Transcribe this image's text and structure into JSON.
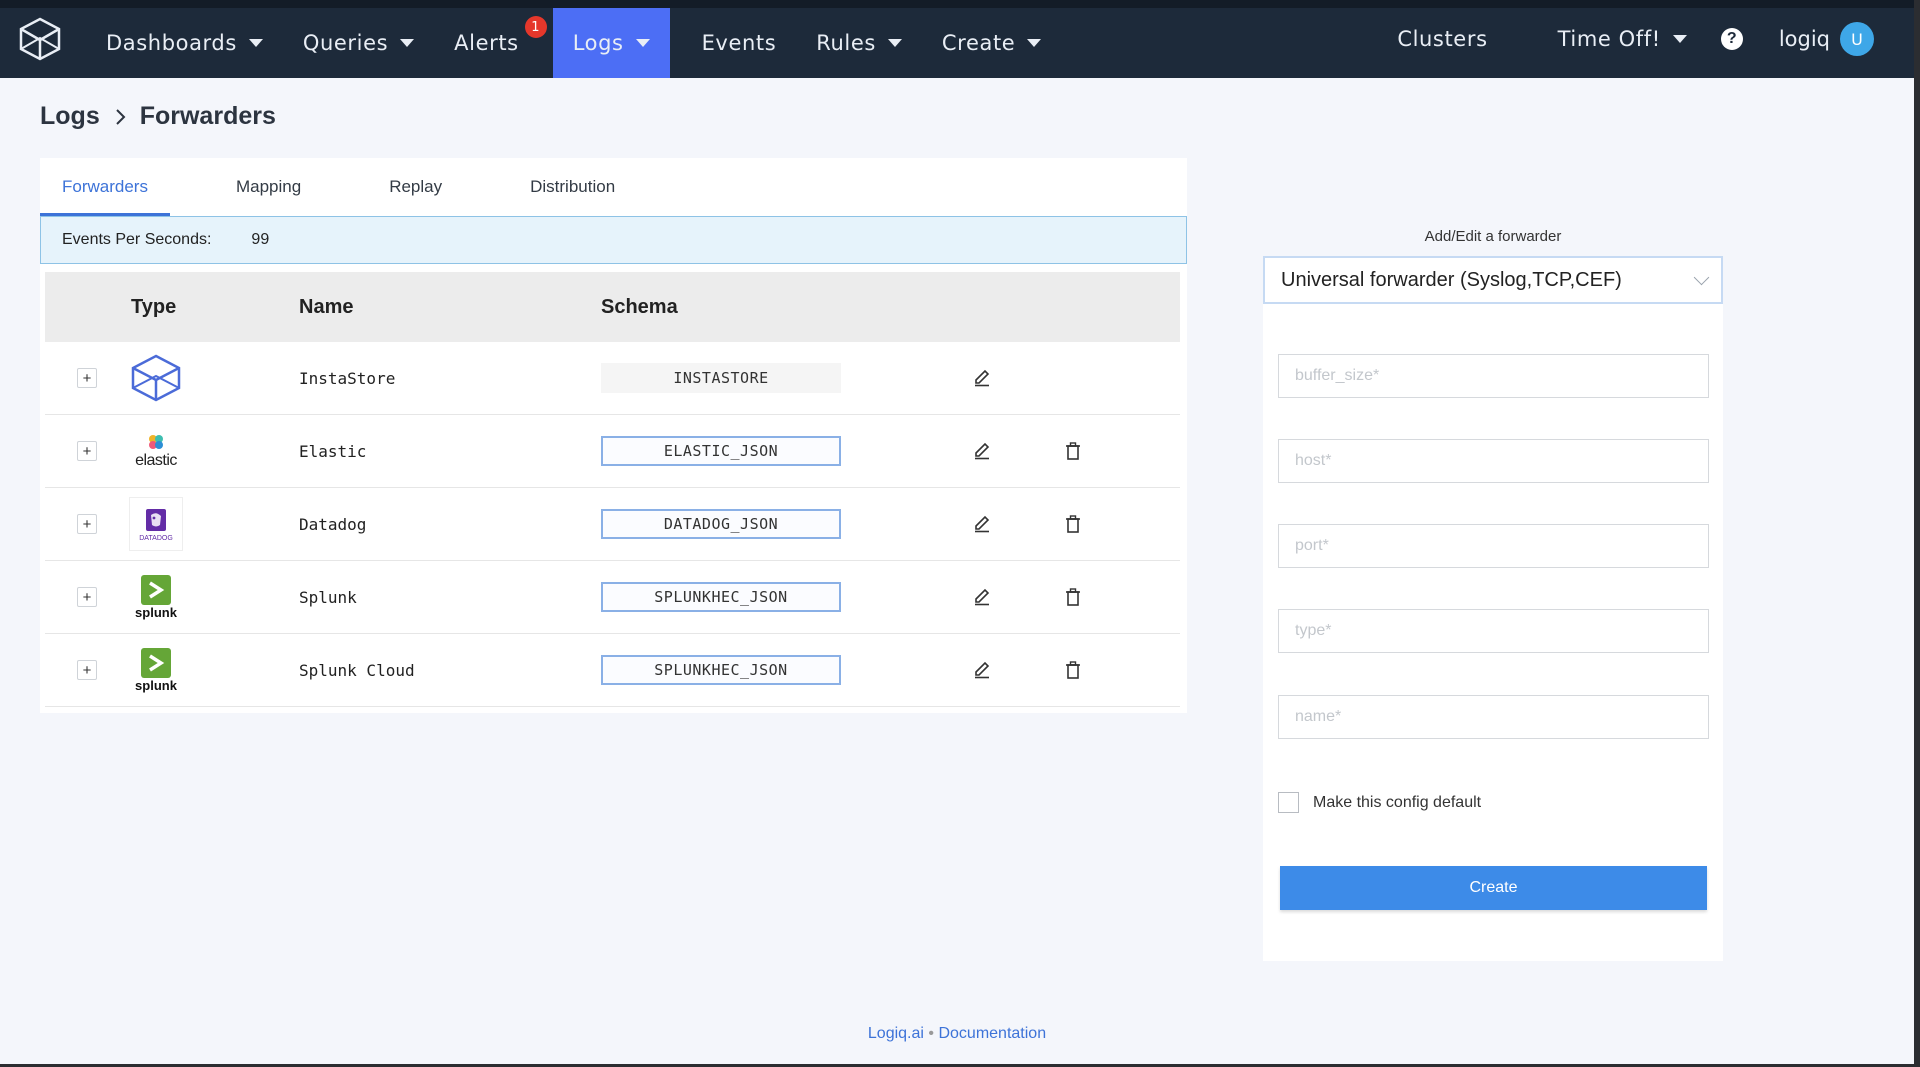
{
  "nav": {
    "items": [
      {
        "label": "Dashboards"
      },
      {
        "label": "Queries"
      },
      {
        "label": "Alerts",
        "badge": "1"
      },
      {
        "label": "Logs"
      },
      {
        "label": "Events"
      },
      {
        "label": "Rules"
      },
      {
        "label": "Create"
      }
    ],
    "right": {
      "clusters": "Clusters",
      "time_off": "Time Off!",
      "user": "logiq",
      "avatar_initial": "U"
    }
  },
  "breadcrumb": {
    "root": "Logs",
    "current": "Forwarders"
  },
  "tabs": [
    "Forwarders",
    "Mapping",
    "Replay",
    "Distribution"
  ],
  "eps": {
    "label": "Events Per Seconds:",
    "value": "99"
  },
  "table": {
    "headers": {
      "type": "Type",
      "name": "Name",
      "schema": "Schema"
    },
    "rows": [
      {
        "icon": "instastore-logo-icon",
        "name": "InstaStore",
        "schema": "INSTASTORE"
      },
      {
        "icon": "elastic-logo-icon",
        "name": "Elastic",
        "schema": "ELASTIC_JSON"
      },
      {
        "icon": "datadog-logo-icon",
        "name": "Datadog",
        "schema": "DATADOG_JSON"
      },
      {
        "icon": "splunk-logo-icon",
        "name": "Splunk",
        "schema": "SPLUNKHEC_JSON"
      },
      {
        "icon": "splunk-logo-icon",
        "name": "Splunk Cloud",
        "schema": "SPLUNKHEC_JSON"
      }
    ]
  },
  "form": {
    "title": "Add/Edit a forwarder",
    "selected": "Universal forwarder (Syslog,TCP,CEF)",
    "fields": {
      "buffer_size": "buffer_size*",
      "host": "host*",
      "port": "port*",
      "type": "type*",
      "name": "name*"
    },
    "default_label": "Make this config default",
    "submit": "Create"
  },
  "footer": {
    "brand": "Logiq.ai",
    "sep": "•",
    "docs": "Documentation"
  },
  "logo_text": {
    "elastic": "elastic",
    "datadog": "DATADOG",
    "splunk": "splunk"
  },
  "colors": {
    "nav_bg": "#1d2a3a",
    "accent": "#4c6ef5",
    "link": "#3d73d8",
    "button": "#3d8be8",
    "badge": "#e5372b"
  }
}
